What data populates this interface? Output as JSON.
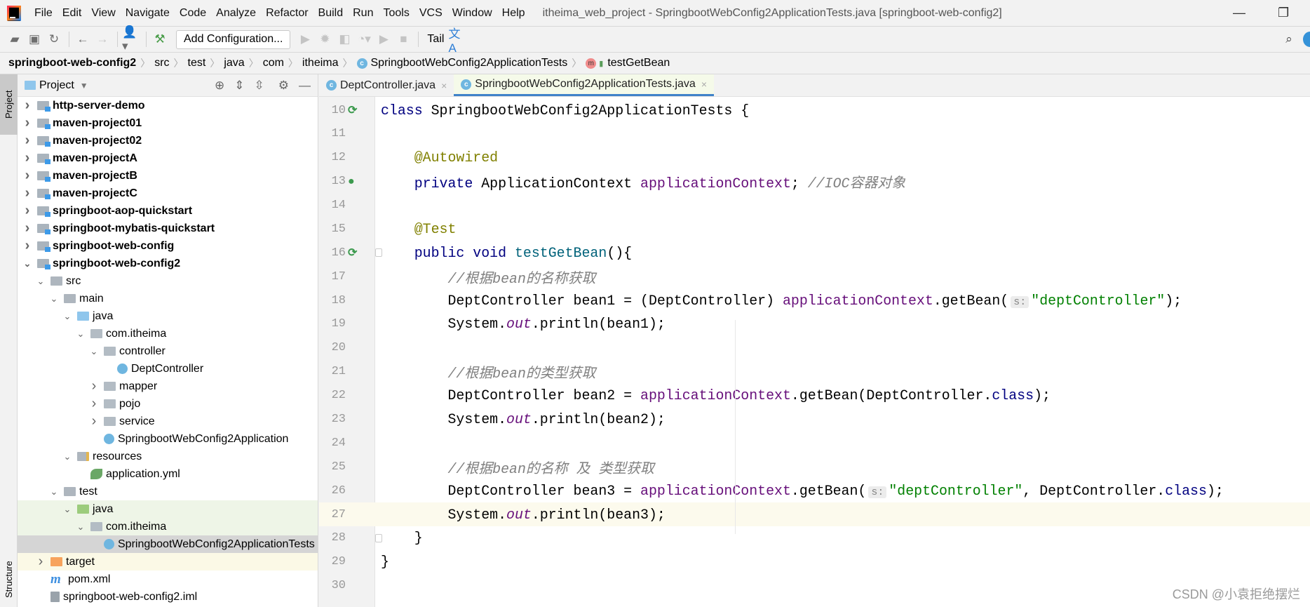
{
  "menubar": {
    "items": [
      "File",
      "Edit",
      "View",
      "Navigate",
      "Code",
      "Analyze",
      "Refactor",
      "Build",
      "Run",
      "Tools",
      "VCS",
      "Window",
      "Help"
    ],
    "window_title": "itheima_web_project - SpringbootWebConfig2ApplicationTests.java [springboot-web-config2]"
  },
  "toolbar": {
    "add_configuration": "Add Configuration...",
    "tail": "Tail"
  },
  "breadcrumb": [
    "springboot-web-config2",
    "src",
    "test",
    "java",
    "com",
    "itheima",
    "SpringbootWebConfig2ApplicationTests",
    "testGetBean"
  ],
  "left_stripe": {
    "project": "Project",
    "structure": "Structure"
  },
  "project_panel": {
    "title": "Project",
    "tree": [
      {
        "label": "http-server-demo",
        "depth": 0,
        "arrow": "right",
        "icon": "module",
        "bold": true
      },
      {
        "label": "maven-project01",
        "depth": 0,
        "arrow": "right",
        "icon": "module",
        "bold": true
      },
      {
        "label": "maven-project02",
        "depth": 0,
        "arrow": "right",
        "icon": "module",
        "bold": true
      },
      {
        "label": "maven-projectA",
        "depth": 0,
        "arrow": "right",
        "icon": "module",
        "bold": true
      },
      {
        "label": "maven-projectB",
        "depth": 0,
        "arrow": "right",
        "icon": "module",
        "bold": true
      },
      {
        "label": "maven-projectC",
        "depth": 0,
        "arrow": "right",
        "icon": "module",
        "bold": true
      },
      {
        "label": "springboot-aop-quickstart",
        "depth": 0,
        "arrow": "right",
        "icon": "module",
        "bold": true
      },
      {
        "label": "springboot-mybatis-quickstart",
        "depth": 0,
        "arrow": "right",
        "icon": "module",
        "bold": true
      },
      {
        "label": "springboot-web-config",
        "depth": 0,
        "arrow": "right",
        "icon": "module",
        "bold": true
      },
      {
        "label": "springboot-web-config2",
        "depth": 0,
        "arrow": "down",
        "icon": "module",
        "bold": true
      },
      {
        "label": "src",
        "depth": 1,
        "arrow": "down",
        "icon": "folder"
      },
      {
        "label": "main",
        "depth": 2,
        "arrow": "down",
        "icon": "folder"
      },
      {
        "label": "java",
        "depth": 3,
        "arrow": "down",
        "icon": "src"
      },
      {
        "label": "com.itheima",
        "depth": 4,
        "arrow": "down",
        "icon": "pkg"
      },
      {
        "label": "controller",
        "depth": 5,
        "arrow": "down",
        "icon": "pkg"
      },
      {
        "label": "DeptController",
        "depth": 6,
        "arrow": "",
        "icon": "class"
      },
      {
        "label": "mapper",
        "depth": 5,
        "arrow": "right",
        "icon": "pkg"
      },
      {
        "label": "pojo",
        "depth": 5,
        "arrow": "right",
        "icon": "pkg"
      },
      {
        "label": "service",
        "depth": 5,
        "arrow": "right",
        "icon": "pkg"
      },
      {
        "label": "SpringbootWebConfig2Application",
        "depth": 5,
        "arrow": "",
        "icon": "class",
        "arrow_space": true
      },
      {
        "label": "resources",
        "depth": 3,
        "arrow": "down",
        "icon": "res"
      },
      {
        "label": "application.yml",
        "depth": 4,
        "arrow": "",
        "icon": "yml",
        "arrow_space": true
      },
      {
        "label": "test",
        "depth": 2,
        "arrow": "down",
        "icon": "folder"
      },
      {
        "label": "java",
        "depth": 3,
        "arrow": "down",
        "icon": "test",
        "bg": "test"
      },
      {
        "label": "com.itheima",
        "depth": 4,
        "arrow": "down",
        "icon": "pkg",
        "bg": "test"
      },
      {
        "label": "SpringbootWebConfig2ApplicationTests",
        "depth": 5,
        "arrow": "",
        "icon": "class",
        "arrow_space": true,
        "bg": "sel"
      },
      {
        "label": "target",
        "depth": 1,
        "arrow": "right",
        "icon": "excl",
        "bg": "excl"
      },
      {
        "label": "pom.xml",
        "depth": 1,
        "arrow": "",
        "icon": "m",
        "arrow_space": true
      },
      {
        "label": "springboot-web-config2.iml",
        "depth": 1,
        "arrow": "",
        "icon": "iml",
        "arrow_space": true
      }
    ]
  },
  "editor": {
    "tabs": [
      {
        "label": "DeptController.java",
        "active": false
      },
      {
        "label": "SpringbootWebConfig2ApplicationTests.java",
        "active": true
      }
    ],
    "current_line": 27,
    "lines": [
      {
        "n": "10",
        "gutter": "run",
        "seg": [
          [
            "class ",
            "k"
          ],
          [
            "SpringbootWebConfig2ApplicationTests {",
            ""
          ]
        ]
      },
      {
        "n": "11",
        "seg": []
      },
      {
        "n": "12",
        "seg": [
          [
            "    ",
            ""
          ],
          [
            "@Autowired",
            "a"
          ]
        ]
      },
      {
        "n": "13",
        "gutter": "bean",
        "seg": [
          [
            "    ",
            ""
          ],
          [
            "private ",
            "k"
          ],
          [
            "ApplicationContext ",
            ""
          ],
          [
            "applicationContext",
            "f"
          ],
          [
            "; ",
            ""
          ],
          [
            "//IOC容器对象",
            "cm"
          ]
        ]
      },
      {
        "n": "14",
        "seg": []
      },
      {
        "n": "15",
        "seg": [
          [
            "    ",
            ""
          ],
          [
            "@Test",
            "a"
          ]
        ]
      },
      {
        "n": "16",
        "gutter": "run",
        "fold": true,
        "seg": [
          [
            "    ",
            ""
          ],
          [
            "public void ",
            "k"
          ],
          [
            "testGetBean",
            "md"
          ],
          [
            "(){",
            ""
          ]
        ]
      },
      {
        "n": "17",
        "seg": [
          [
            "        ",
            ""
          ],
          [
            "//根据bean的名称获取",
            "cm"
          ]
        ]
      },
      {
        "n": "18",
        "seg": [
          [
            "        DeptController bean1 = (DeptController) ",
            ""
          ],
          [
            "applicationContext",
            "f"
          ],
          [
            ".getBean(",
            ""
          ],
          [
            "s:",
            "hint"
          ],
          [
            "\"deptController\"",
            "s"
          ],
          [
            ");",
            ""
          ]
        ]
      },
      {
        "n": "19",
        "seg": [
          [
            "        System.",
            ""
          ],
          [
            "out",
            "sf"
          ],
          [
            ".println(bean1);",
            ""
          ]
        ]
      },
      {
        "n": "20",
        "seg": []
      },
      {
        "n": "21",
        "seg": [
          [
            "        ",
            ""
          ],
          [
            "//根据bean的类型获取",
            "cm"
          ]
        ]
      },
      {
        "n": "22",
        "seg": [
          [
            "        DeptController bean2 = ",
            ""
          ],
          [
            "applicationContext",
            "f"
          ],
          [
            ".getBean(DeptController.",
            ""
          ],
          [
            "class",
            "k"
          ],
          [
            ");",
            ""
          ]
        ]
      },
      {
        "n": "23",
        "seg": [
          [
            "        System.",
            ""
          ],
          [
            "out",
            "sf"
          ],
          [
            ".println(bean2);",
            ""
          ]
        ]
      },
      {
        "n": "24",
        "seg": []
      },
      {
        "n": "25",
        "seg": [
          [
            "        ",
            ""
          ],
          [
            "//根据bean的名称 及 类型获取",
            "cm"
          ]
        ]
      },
      {
        "n": "26",
        "seg": [
          [
            "        DeptController bean3 = ",
            ""
          ],
          [
            "applicationContext",
            "f"
          ],
          [
            ".getBean(",
            ""
          ],
          [
            "s:",
            "hint"
          ],
          [
            "\"deptController\"",
            "s"
          ],
          [
            ", DeptController.",
            ""
          ],
          [
            "class",
            "k"
          ],
          [
            ");",
            ""
          ]
        ]
      },
      {
        "n": "27",
        "seg": [
          [
            "        System.",
            ""
          ],
          [
            "out",
            "sf"
          ],
          [
            ".println(bean3);",
            ""
          ]
        ]
      },
      {
        "n": "28",
        "fold": true,
        "seg": [
          [
            "    }",
            ""
          ]
        ]
      },
      {
        "n": "29",
        "seg": [
          [
            "}",
            ""
          ]
        ]
      },
      {
        "n": "30",
        "seg": []
      }
    ]
  },
  "watermark": "CSDN @小袁拒绝摆烂"
}
